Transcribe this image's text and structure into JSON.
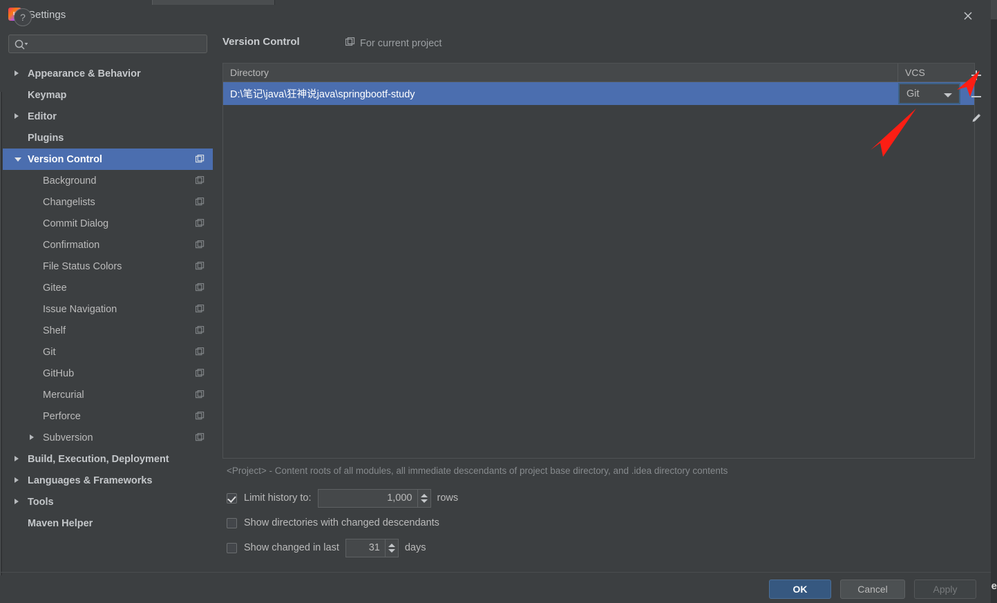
{
  "window": {
    "title": "Settings",
    "app_icon": "intellij-idea-icon",
    "close_icon": "close-icon"
  },
  "sidebar": {
    "search": {
      "placeholder": "",
      "value": "",
      "icon": "search-icon"
    },
    "items": [
      {
        "label": "Appearance & Behavior",
        "level": 0,
        "arrow": "right",
        "bold": true,
        "scope_icon": false,
        "selected": false
      },
      {
        "label": "Keymap",
        "level": 0,
        "arrow": "none",
        "bold": true,
        "scope_icon": false,
        "selected": false
      },
      {
        "label": "Editor",
        "level": 0,
        "arrow": "right",
        "bold": true,
        "scope_icon": false,
        "selected": false
      },
      {
        "label": "Plugins",
        "level": 0,
        "arrow": "none",
        "bold": true,
        "scope_icon": false,
        "selected": false
      },
      {
        "label": "Version Control",
        "level": 0,
        "arrow": "down",
        "bold": true,
        "scope_icon": true,
        "selected": true
      },
      {
        "label": "Background",
        "level": 1,
        "arrow": "none",
        "bold": false,
        "scope_icon": true,
        "selected": false
      },
      {
        "label": "Changelists",
        "level": 1,
        "arrow": "none",
        "bold": false,
        "scope_icon": true,
        "selected": false
      },
      {
        "label": "Commit Dialog",
        "level": 1,
        "arrow": "none",
        "bold": false,
        "scope_icon": true,
        "selected": false
      },
      {
        "label": "Confirmation",
        "level": 1,
        "arrow": "none",
        "bold": false,
        "scope_icon": true,
        "selected": false
      },
      {
        "label": "File Status Colors",
        "level": 1,
        "arrow": "none",
        "bold": false,
        "scope_icon": true,
        "selected": false
      },
      {
        "label": "Gitee",
        "level": 1,
        "arrow": "none",
        "bold": false,
        "scope_icon": true,
        "selected": false
      },
      {
        "label": "Issue Navigation",
        "level": 1,
        "arrow": "none",
        "bold": false,
        "scope_icon": true,
        "selected": false
      },
      {
        "label": "Shelf",
        "level": 1,
        "arrow": "none",
        "bold": false,
        "scope_icon": true,
        "selected": false
      },
      {
        "label": "Git",
        "level": 1,
        "arrow": "none",
        "bold": false,
        "scope_icon": true,
        "selected": false
      },
      {
        "label": "GitHub",
        "level": 1,
        "arrow": "none",
        "bold": false,
        "scope_icon": true,
        "selected": false
      },
      {
        "label": "Mercurial",
        "level": 1,
        "arrow": "none",
        "bold": false,
        "scope_icon": true,
        "selected": false
      },
      {
        "label": "Perforce",
        "level": 1,
        "arrow": "none",
        "bold": false,
        "scope_icon": true,
        "selected": false
      },
      {
        "label": "Subversion",
        "level": 1,
        "arrow": "right",
        "bold": false,
        "scope_icon": true,
        "selected": false
      },
      {
        "label": "Build, Execution, Deployment",
        "level": 0,
        "arrow": "right",
        "bold": true,
        "scope_icon": false,
        "selected": false
      },
      {
        "label": "Languages & Frameworks",
        "level": 0,
        "arrow": "right",
        "bold": true,
        "scope_icon": false,
        "selected": false
      },
      {
        "label": "Tools",
        "level": 0,
        "arrow": "right",
        "bold": true,
        "scope_icon": false,
        "selected": false
      },
      {
        "label": "Maven Helper",
        "level": 0,
        "arrow": "none",
        "bold": true,
        "scope_icon": false,
        "selected": false
      }
    ]
  },
  "main": {
    "page_title": "Version Control",
    "scope_note": "For current project",
    "scope_note_icon": "project-scope-icon",
    "table": {
      "columns": [
        "Directory",
        "VCS"
      ],
      "rows": [
        {
          "directory": "D:\\笔记\\java\\狂神说java\\springbootf-study",
          "vcs": "Git",
          "selected": true
        }
      ]
    },
    "toolbar": [
      {
        "name": "add-button",
        "icon": "plus-icon"
      },
      {
        "name": "remove-button",
        "icon": "minus-icon"
      },
      {
        "name": "edit-button",
        "icon": "pencil-icon"
      }
    ],
    "description": "<Project> - Content roots of all modules, all immediate descendants of project base directory, and .idea directory contents",
    "options": {
      "limit_history": {
        "label_before": "Limit history to:",
        "value": "1,000",
        "label_after": "rows",
        "checked": true
      },
      "show_directories": {
        "label": "Show directories with changed descendants",
        "checked": false
      },
      "show_changed": {
        "label_before": "Show changed in last",
        "value": "31",
        "label_after": "days",
        "checked": false
      }
    }
  },
  "footer": {
    "help_label": "?",
    "ok_label": "OK",
    "cancel_label": "Cancel",
    "apply_label": "Apply"
  },
  "annotations": {
    "arrow_color": "#fc1e14",
    "arrow_upper": "points-at-remove-button",
    "arrow_lower": "points-at-vcs-git-dropdown"
  },
  "background_bleed": {
    "right_edge_letter": "e"
  },
  "colors": {
    "dialog_bg": "#3c3f41",
    "selection_blue": "#4b6eaf",
    "primary_button": "#365880",
    "annotation_red": "#fc1e14"
  }
}
